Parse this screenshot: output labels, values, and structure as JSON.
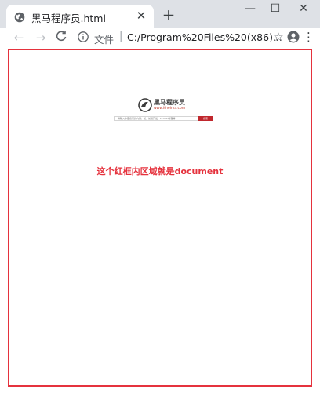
{
  "tab": {
    "title": "黑马程序员.html",
    "close_glyph": "✕",
    "icon": "globe-icon"
  },
  "new_tab_glyph": "+",
  "window_controls": {
    "minimize": "—",
    "maximize": "☐",
    "close": "✕"
  },
  "toolbar": {
    "back_glyph": "←",
    "forward_glyph": "→",
    "reload_glyph": "C",
    "star_glyph": "☆",
    "menu_glyph": "⋮"
  },
  "address": {
    "scheme_label": "文件",
    "separator": "|",
    "url": "C:/Program%20Files%20(x86)..."
  },
  "page": {
    "logo": {
      "name": "黑马程序员",
      "domain": "www.itheima.com"
    },
    "search": {
      "placeholder": "请输入你要搜索的内容，如：前端开发，Python教程等"
    },
    "search_button_label": "搜索",
    "note": "这个红框内区域就是document"
  },
  "colors": {
    "frame_red": "#e5323d",
    "brand_red": "#c0272d",
    "tabstrip": "#dee1e6"
  }
}
